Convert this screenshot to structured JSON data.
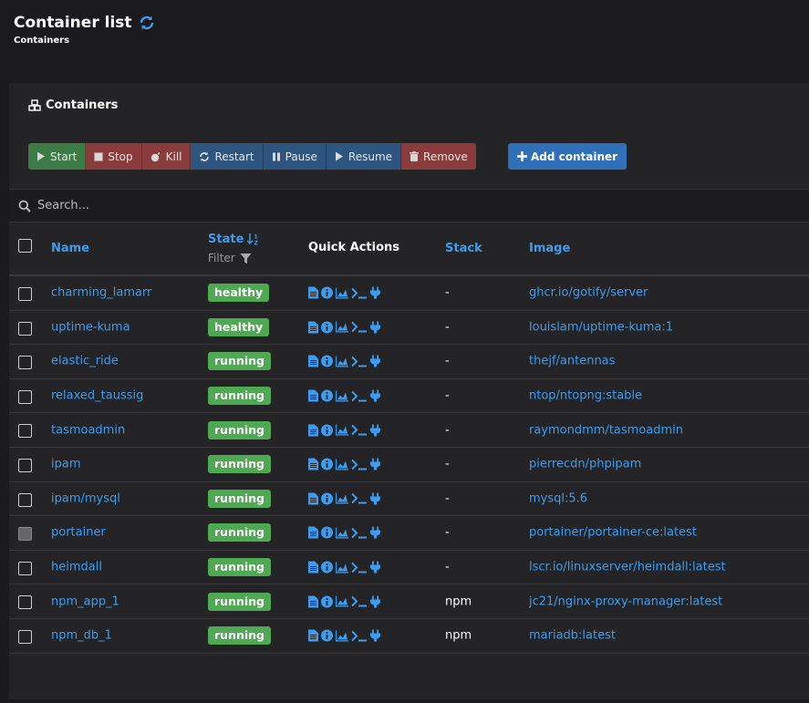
{
  "header": {
    "title": "Container list",
    "breadcrumb": "Containers"
  },
  "panel": {
    "title": "Containers"
  },
  "actions": {
    "start": "Start",
    "stop": "Stop",
    "kill": "Kill",
    "restart": "Restart",
    "pause": "Pause",
    "resume": "Resume",
    "remove": "Remove",
    "add": "Add container"
  },
  "search": {
    "placeholder": "Search..."
  },
  "columns": {
    "name": "Name",
    "state": "State",
    "filter": "Filter",
    "quick_actions": "Quick Actions",
    "stack": "Stack",
    "image": "Image"
  },
  "icons": [
    "refresh-icon",
    "cubes-icon",
    "play-icon",
    "stop-icon",
    "bomb-icon",
    "sync-icon",
    "pause-icon",
    "remove-icon",
    "plus-icon",
    "search-icon",
    "sort-icon",
    "filter-icon",
    "logs-icon",
    "info-icon",
    "stats-icon",
    "console-icon",
    "attach-icon"
  ],
  "colors": {
    "accent": "#3b9cf0",
    "healthy": "#4ea952",
    "start": "#3c7a46",
    "danger": "#8a3b3b",
    "neutral": "#2e5480",
    "add": "#2f70b8"
  },
  "containers": [
    {
      "name": "charming_lamarr",
      "state": "healthy",
      "stack": "-",
      "image": "ghcr.io/gotify/server"
    },
    {
      "name": "uptime-kuma",
      "state": "healthy",
      "stack": "-",
      "image": "louislam/uptime-kuma:1"
    },
    {
      "name": "elastic_ride",
      "state": "running",
      "stack": "-",
      "image": "thejf/antennas"
    },
    {
      "name": "relaxed_taussig",
      "state": "running",
      "stack": "-",
      "image": "ntop/ntopng:stable"
    },
    {
      "name": "tasmoadmin",
      "state": "running",
      "stack": "-",
      "image": "raymondmm/tasmoadmin"
    },
    {
      "name": "ipam",
      "state": "running",
      "stack": "-",
      "image": "pierrecdn/phpipam"
    },
    {
      "name": "ipam/mysql",
      "state": "running",
      "stack": "-",
      "image": "mysql:5.6"
    },
    {
      "name": "portainer",
      "state": "running",
      "stack": "-",
      "image": "portainer/portainer-ce:latest"
    },
    {
      "name": "heimdall",
      "state": "running",
      "stack": "-",
      "image": "lscr.io/linuxserver/heimdall:latest"
    },
    {
      "name": "npm_app_1",
      "state": "running",
      "stack": "npm",
      "image": "jc21/nginx-proxy-manager:latest"
    },
    {
      "name": "npm_db_1",
      "state": "running",
      "stack": "npm",
      "image": "mariadb:latest"
    }
  ]
}
